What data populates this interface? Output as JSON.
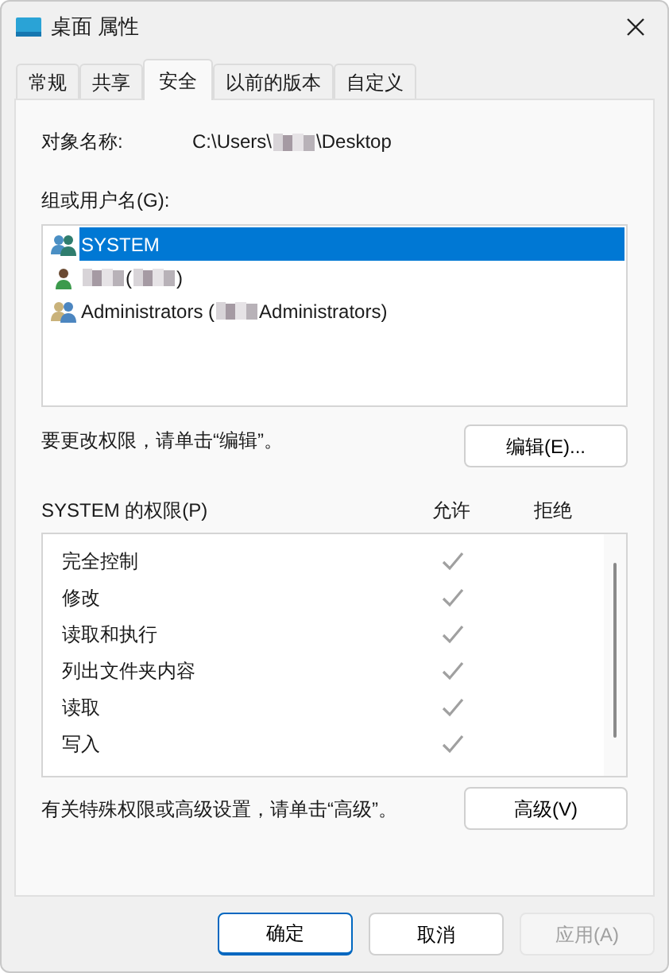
{
  "window": {
    "title": "桌面 属性"
  },
  "tabs": [
    {
      "label": "常规",
      "selected": false
    },
    {
      "label": "共享",
      "selected": false
    },
    {
      "label": "安全",
      "selected": true
    },
    {
      "label": "以前的版本",
      "selected": false
    },
    {
      "label": "自定义",
      "selected": false
    }
  ],
  "object_name": {
    "label": "对象名称:",
    "path": [
      {
        "kind": "text",
        "text": "C:\\Users\\"
      },
      {
        "kind": "redacted"
      },
      {
        "kind": "text",
        "text": "\\Desktop"
      }
    ]
  },
  "groups": {
    "label": "组或用户名(G):",
    "items": [
      {
        "kind": "system",
        "selected": true,
        "parts": [
          {
            "kind": "text",
            "text": "SYSTEM"
          }
        ]
      },
      {
        "kind": "user",
        "selected": false,
        "parts": [
          {
            "kind": "redacted"
          },
          {
            "kind": "text",
            "text": "("
          },
          {
            "kind": "redacted"
          },
          {
            "kind": "text",
            "text": ")"
          }
        ]
      },
      {
        "kind": "admins",
        "selected": false,
        "parts": [
          {
            "kind": "text",
            "text": "Administrators ("
          },
          {
            "kind": "redacted"
          },
          {
            "kind": "text",
            "text": "Administrators)"
          }
        ]
      }
    ]
  },
  "edit_hint": "要更改权限，请单击“编辑”。",
  "edit_button": "编辑(E)...",
  "permissions": {
    "label": "SYSTEM 的权限(P)",
    "allow_header": "允许",
    "deny_header": "拒绝",
    "rows": [
      {
        "name": "完全控制",
        "allow": true
      },
      {
        "name": "修改",
        "allow": true
      },
      {
        "name": "读取和执行",
        "allow": true
      },
      {
        "name": "列出文件夹内容",
        "allow": true
      },
      {
        "name": "读取",
        "allow": true
      },
      {
        "name": "写入",
        "allow": true
      }
    ]
  },
  "advanced_hint": "有关特殊权限或高级设置，请单击“高级”。",
  "advanced_button": "高级(V)",
  "buttons": [
    {
      "label": "确定",
      "kind": "default",
      "disabled": false
    },
    {
      "label": "取消",
      "kind": "normal",
      "disabled": false
    },
    {
      "label": "应用(A)",
      "kind": "normal",
      "disabled": true
    }
  ]
}
